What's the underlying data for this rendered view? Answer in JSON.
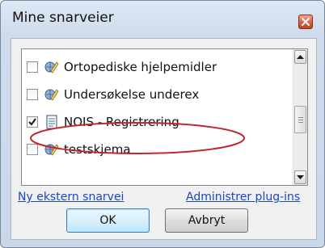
{
  "dialog": {
    "title": "Mine snarveier"
  },
  "list": {
    "items": [
      {
        "label": "Ortopediske hjelpemidler",
        "checked": false,
        "icon": "web-form-icon"
      },
      {
        "label": "Undersøkelse underex",
        "checked": false,
        "icon": "web-form-icon"
      },
      {
        "label": "NOIS - Registrering",
        "checked": true,
        "icon": "document-icon"
      },
      {
        "label": "testskjema",
        "checked": false,
        "icon": "web-form-icon"
      }
    ]
  },
  "links": {
    "new_external": "Ny ekstern snarvei",
    "manage_plugins": "Administrer plug-ins"
  },
  "buttons": {
    "ok": "OK",
    "cancel": "Avbryt"
  },
  "colors": {
    "highlight_ellipse": "#c0262b",
    "link": "#1a46c8",
    "close_button": "#d85f43"
  }
}
